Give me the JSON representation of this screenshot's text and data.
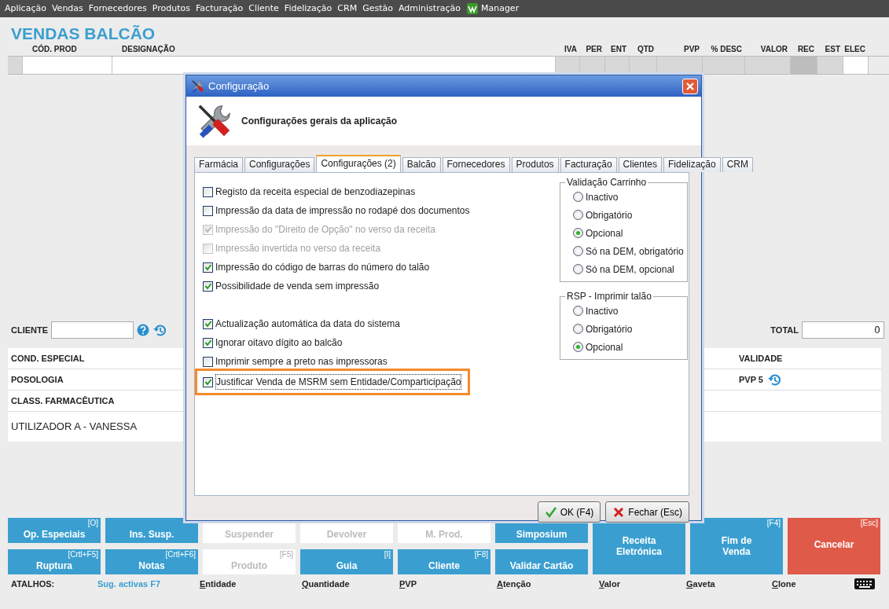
{
  "menu": {
    "items": [
      "Aplicação",
      "Vendas",
      "Fornecedores",
      "Produtos",
      "Facturação",
      "Cliente",
      "Fidelização",
      "CRM",
      "Gestão",
      "Administração"
    ],
    "app": "Manager"
  },
  "page_title": "VENDAS BALCÃO",
  "columns": [
    {
      "label": "CÓD. PROD",
      "kind": "input"
    },
    {
      "label": "DESIGNAÇÃO",
      "kind": "input"
    },
    {
      "label": "IVA",
      "kind": "readonly"
    },
    {
      "label": "PER",
      "kind": "readonly"
    },
    {
      "label": "ENT",
      "kind": "readonly"
    },
    {
      "label": "QTD",
      "kind": "readonly"
    },
    {
      "label": "PVP",
      "kind": "readonly"
    },
    {
      "label": "% DESC",
      "kind": "readonly"
    },
    {
      "label": "VALOR",
      "kind": "readonly"
    },
    {
      "label": "REC",
      "kind": "locked"
    },
    {
      "label": "EST",
      "kind": "readonly"
    },
    {
      "label": "ELEC",
      "kind": "input"
    }
  ],
  "client": {
    "label": "CLIENTE"
  },
  "total": {
    "label": "TOTAL",
    "value": "0"
  },
  "info_rows": [
    {
      "label": "COND. ESPECIAL",
      "right": "VALIDADE",
      "kind": "field"
    },
    {
      "label": "POSOLOGIA",
      "right": "PVP 5",
      "kind": "field"
    },
    {
      "label": "CLASS. FARMACÊUTICA",
      "kind": "field"
    },
    {
      "label": "UTILIZADOR A - VANESSA",
      "kind": "user"
    }
  ],
  "actions": [
    {
      "label": "Op. Especiais",
      "hotkey": "[O]",
      "kind": "primary"
    },
    {
      "label": "Ins. Susp.",
      "kind": "primary"
    },
    {
      "label": "Suspender",
      "kind": "disabled"
    },
    {
      "label": "Devolver",
      "kind": "disabled"
    },
    {
      "label": "M. Prod.",
      "kind": "disabled"
    },
    {
      "label": "Simposium",
      "kind": "primary"
    },
    {
      "label": "Receita Eletrónica",
      "kind": "tall"
    },
    {
      "label": "Fim de Venda",
      "hotkey": "[F4]",
      "kind": "tall"
    },
    {
      "label": "Cancelar",
      "hotkey": "[Esc]",
      "kind": "danger"
    },
    {
      "label": "Ruptura",
      "hotkey": "[Crtl+F5]",
      "kind": "primary"
    },
    {
      "label": "Notas",
      "hotkey": "[Crtl+F6]",
      "kind": "primary"
    },
    {
      "label": "Produto",
      "hotkey": "[F5]",
      "kind": "disabled"
    },
    {
      "label": "Guia",
      "hotkey": "[I]",
      "kind": "primary"
    },
    {
      "label": "Cliente",
      "hotkey": "[F8]",
      "kind": "primary"
    },
    {
      "label": "Validar Cartão",
      "kind": "primary"
    }
  ],
  "shortcuts": {
    "label": "ATALHOS:",
    "items": [
      {
        "label": "Sug. activas F7",
        "kind": "link"
      },
      {
        "label": "Entidade",
        "kind": "key"
      },
      {
        "label": "Quantidade",
        "kind": "key"
      },
      {
        "label": "PVP",
        "kind": "key"
      },
      {
        "label": "Atenção",
        "kind": "key"
      },
      {
        "label": "Valor",
        "kind": "key"
      },
      {
        "label": "Gaveta",
        "kind": "key"
      },
      {
        "label": "Clone",
        "kind": "key"
      }
    ]
  },
  "dialog": {
    "title": "Configuração",
    "heading": "Configurações gerais da aplicação",
    "tabs": [
      {
        "label": "Farmácia",
        "selected": false
      },
      {
        "label": "Configurações",
        "selected": false
      },
      {
        "label": "Configurações (2)",
        "selected": true
      },
      {
        "label": "Balcão",
        "selected": false
      },
      {
        "label": "Fornecedores",
        "selected": false
      },
      {
        "label": "Produtos",
        "selected": false
      },
      {
        "label": "Facturação",
        "selected": false
      },
      {
        "label": "Clientes",
        "selected": false
      },
      {
        "label": "Fidelização",
        "selected": false
      },
      {
        "label": "CRM",
        "selected": false
      }
    ],
    "option_groups": [
      {
        "options": [
          {
            "label": "Registo da receita especial de benzodiazepinas",
            "checked": false,
            "disabled": false,
            "highlighted": false
          },
          {
            "label": "Impressão da data de impressão no rodapé dos documentos",
            "checked": false,
            "disabled": false,
            "highlighted": false
          },
          {
            "label": "Impressão do \"Direito de Opção\" no verso da receita",
            "checked": true,
            "disabled": true,
            "highlighted": false
          },
          {
            "label": "Impressão invertida no verso da receita",
            "checked": false,
            "disabled": true,
            "highlighted": false
          },
          {
            "label": "Impressão do código de barras do número do talão",
            "checked": true,
            "disabled": false,
            "highlighted": false
          },
          {
            "label": "Possibilidade de venda sem impressão",
            "checked": true,
            "disabled": false,
            "highlighted": false
          }
        ]
      },
      {
        "options": [
          {
            "label": "Actualização automática da data do sistema",
            "checked": true,
            "disabled": false,
            "highlighted": false
          },
          {
            "label": "Ignorar oitavo dígito ao balcão",
            "checked": true,
            "disabled": false,
            "highlighted": false
          },
          {
            "label": "Imprimir sempre a preto nas impressoras",
            "checked": false,
            "disabled": false,
            "highlighted": false
          },
          {
            "label": "Justificar Venda de MSRM sem Entidade/Comparticipação",
            "checked": true,
            "disabled": false,
            "highlighted": true
          }
        ]
      }
    ],
    "radio_groups": [
      {
        "title": "Validação Carrinho",
        "options": [
          {
            "label": "Inactivo",
            "selected": false
          },
          {
            "label": "Obrigatório",
            "selected": false
          },
          {
            "label": "Opcional",
            "selected": true
          },
          {
            "label": "Só na DEM, obrigatório",
            "selected": false
          },
          {
            "label": "Só na DEM, opcional",
            "selected": false
          }
        ]
      },
      {
        "title": "RSP - Imprimir talão",
        "options": [
          {
            "label": "Inactivo",
            "selected": false
          },
          {
            "label": "Obrigatório",
            "selected": false
          },
          {
            "label": "Opcional",
            "selected": true
          }
        ]
      }
    ],
    "buttons": [
      {
        "label": "OK (F4)",
        "kind": "ok"
      },
      {
        "label": "Fechar (Esc)",
        "kind": "close"
      }
    ]
  }
}
